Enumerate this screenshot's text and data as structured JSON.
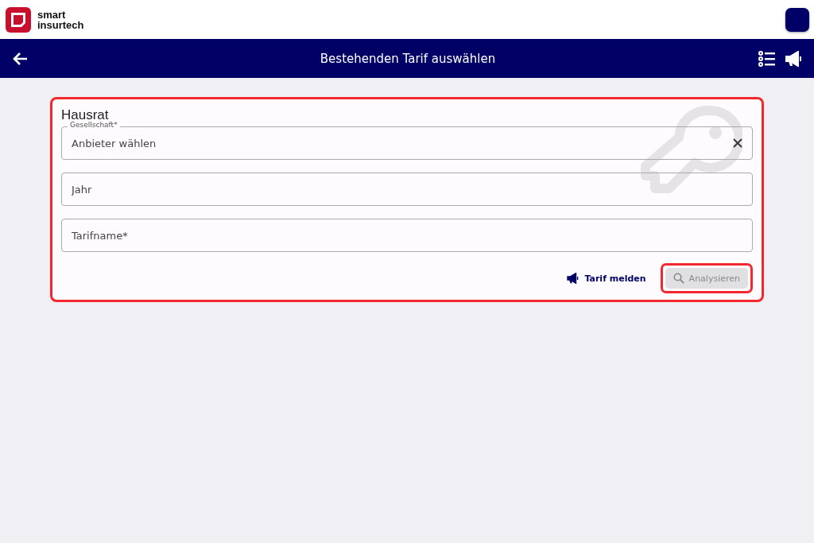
{
  "header": {
    "logo_text": "smart insurtech"
  },
  "navbar": {
    "title": "Bestehenden Tarif auswählen"
  },
  "card": {
    "title": "Hausrat",
    "highlighted": true,
    "fields": [
      {
        "label": "Gesellschaft*",
        "placeholder": "Anbieter wählen",
        "clearable": true
      },
      {
        "placeholder": "Jahr",
        "clearable": false
      },
      {
        "placeholder": "Tarifname*",
        "clearable": false
      }
    ],
    "report_link": "Tarif melden",
    "analyze_button": {
      "label": "Analysieren",
      "disabled": true,
      "highlighted": true
    }
  }
}
